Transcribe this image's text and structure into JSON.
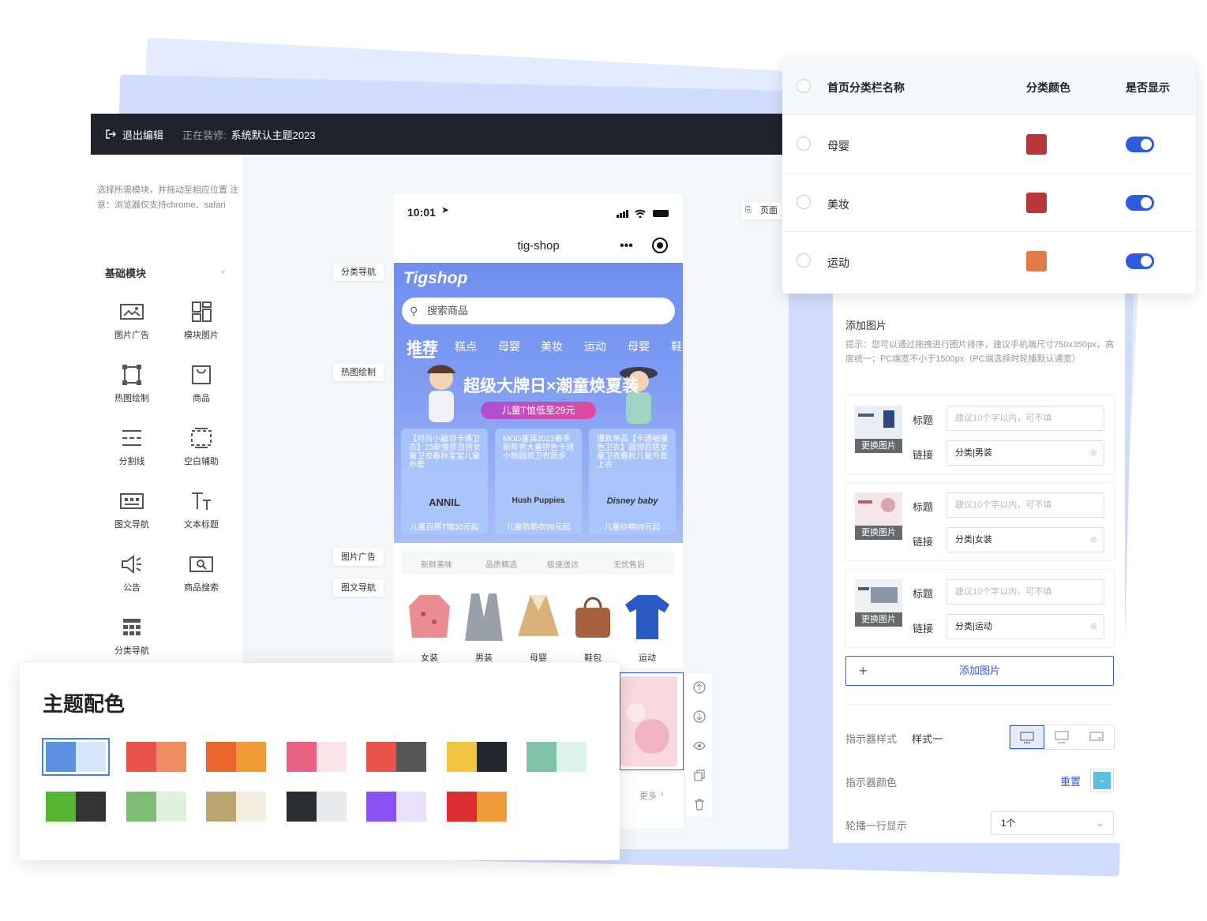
{
  "header": {
    "exit_label": "退出编辑",
    "editing_prefix": "正在装修:",
    "theme_name": "系统默认主题2023"
  },
  "left_panel": {
    "tip": "选择所需模块，并拖动至相应位置 注意：浏览器仅支持chrome、safari",
    "section_title": "基础模块",
    "modules": [
      {
        "label": "图片广告",
        "icon": "image-ad-icon"
      },
      {
        "label": "模块图片",
        "icon": "module-image-icon"
      },
      {
        "label": "热图绘制",
        "icon": "hotspot-icon"
      },
      {
        "label": "商品",
        "icon": "product-bag-icon"
      },
      {
        "label": "分割线",
        "icon": "divider-icon"
      },
      {
        "label": "空白辅助",
        "icon": "blank-icon"
      },
      {
        "label": "图文导航",
        "icon": "image-text-nav-icon"
      },
      {
        "label": "文本标题",
        "icon": "text-title-icon"
      },
      {
        "label": "公告",
        "icon": "announcement-icon"
      },
      {
        "label": "商品搜索",
        "icon": "product-search-icon"
      },
      {
        "label": "分类导航",
        "icon": "category-nav-icon"
      }
    ]
  },
  "canvas_tags": {
    "category_nav": "分类导航",
    "hotspot": "热图绘制",
    "image_ad": "图片广告",
    "image_text_nav": "图文导航",
    "page": "页面"
  },
  "phone": {
    "time": "10:01",
    "title": "tig-shop",
    "logo": "Tigshop",
    "search_placeholder": "搜索商品",
    "categories": [
      "推荐",
      "糕点",
      "母婴",
      "美妆",
      "运动",
      "母婴",
      "鞋"
    ],
    "banner_title": "超级大牌日×潮童焕夏装",
    "banner_pill": "儿童T恤低至29元",
    "cards": [
      {
        "desc": "【时尚小鼬领卡通卫衣】23新慢质百搭女童卫衣春秋宝宝儿童外套",
        "brand": "ANNIL",
        "price": "儿童百搭T恤30元起"
      },
      {
        "desc": "MOD童装2023春季新款男大童拼色卡通小熊圆领卫衣跑步",
        "brand": "Hush Puppies",
        "price": "儿童防晒衣99元起"
      },
      {
        "desc": "爆款单品【卡通袖撞色卫衣】圆领百搭女童卫衣春秋儿童外套上衣",
        "brand": "Disney baby",
        "price": "儿童纱裙69元起"
      }
    ],
    "services": [
      "新鲜美味",
      "品质精选",
      "极速送达",
      "无忧售后"
    ],
    "products": [
      "女装",
      "男装",
      "母婴",
      "鞋包",
      "运动"
    ],
    "more": "更多"
  },
  "category_table": {
    "headers": [
      "首页分类栏名称",
      "分类颜色",
      "是否显示"
    ],
    "rows": [
      {
        "name": "母婴",
        "color": "#b8373a",
        "visible": true
      },
      {
        "name": "美妆",
        "color": "#b8373a",
        "visible": true
      },
      {
        "name": "运动",
        "color": "#e07a47",
        "visible": true
      }
    ]
  },
  "config_panel": {
    "add_image_title": "添加图片",
    "hint": "提示：您可以通过拖拽进行图片排序，建议手机端尺寸750x350px，高度统一；PC端宽不小于1500px（PC端选择时轮播默认通宽）",
    "replace_label": "更换图片",
    "title_label": "标题",
    "link_label": "链接",
    "title_placeholder": "建议10个字以内，可不填",
    "images": [
      {
        "link": "分类|男装"
      },
      {
        "link": "分类|女装"
      },
      {
        "link": "分类|运动"
      }
    ],
    "add_button": "添加图片",
    "indicator_style_label": "指示器样式",
    "indicator_style_value": "样式一",
    "indicator_color_label": "指示器颜色",
    "reset_label": "重置",
    "per_row_label": "轮播一行显示",
    "per_row_value": "1个"
  },
  "theme_palette": {
    "title": "主题配色",
    "swatches": [
      [
        "#5b8fe0",
        "#d6e5fa"
      ],
      [
        "#e8524a",
        "#ef8c62"
      ],
      [
        "#e8662e",
        "#f09a38"
      ],
      [
        "#e96180",
        "#fbe4e8"
      ],
      [
        "#e8524a",
        "#555555"
      ],
      [
        "#f2c540",
        "#232830"
      ],
      [
        "#7fc3aa",
        "#dcf4ec"
      ],
      [
        "#56b533",
        "#333333"
      ],
      [
        "#7fbd76",
        "#e0f2de"
      ],
      [
        "#bba671",
        "#f2eee0"
      ],
      [
        "#2c2d33",
        "#e9eaee"
      ],
      [
        "#8a52f2",
        "#e9e2fb"
      ],
      [
        "#dc2e30",
        "#f09a3a"
      ]
    ]
  }
}
